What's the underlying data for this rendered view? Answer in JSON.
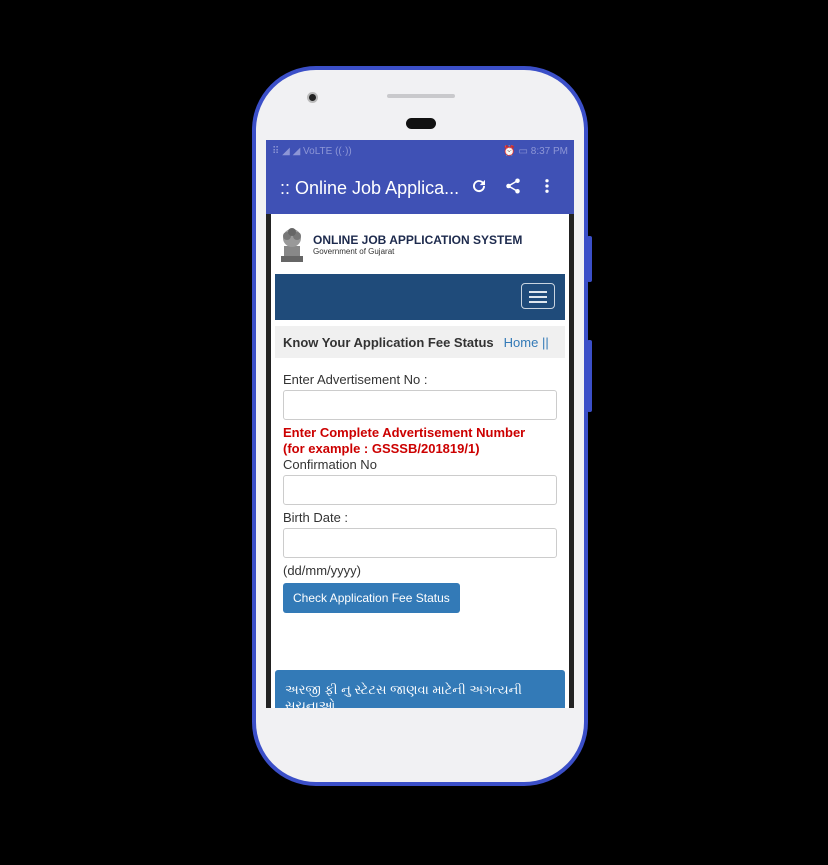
{
  "status_bar": {
    "left": "⠿ ◢ ◢ VoLTE ((·))",
    "right": "⏰ ▭ 8:37 PM"
  },
  "app_bar": {
    "title": ":: Online Job Applica...",
    "actions": [
      "refresh-icon",
      "share-icon",
      "more-vert-icon"
    ]
  },
  "site": {
    "title": "ONLINE JOB APPLICATION SYSTEM",
    "subtitle": "Government of Gujarat"
  },
  "breadcrumb": {
    "title": "Know Your Application Fee Status",
    "home": "Home ||"
  },
  "form": {
    "advt_label": "Enter Advertisement No :",
    "advt_value": "",
    "warning_line1": "Enter Complete Advertisement Number",
    "warning_line2": "(for example : GSSSB/201819/1)",
    "confirm_label": "Confirmation No",
    "confirm_value": "",
    "birth_label": "Birth Date :",
    "birth_value": "",
    "date_hint": "(dd/mm/yyyy)",
    "submit_label": "Check Application Fee Status"
  },
  "notice": {
    "text": "અરજી ફી નુ સ્ટેટસ જાણવા માટેની અગત્યની સુચનાઓ"
  },
  "colors": {
    "app_primary": "#3f51b5",
    "phone_frame": "#3b4fc8",
    "navbar": "#1f4b7a",
    "button": "#337ab7",
    "warning": "#cc0000"
  }
}
